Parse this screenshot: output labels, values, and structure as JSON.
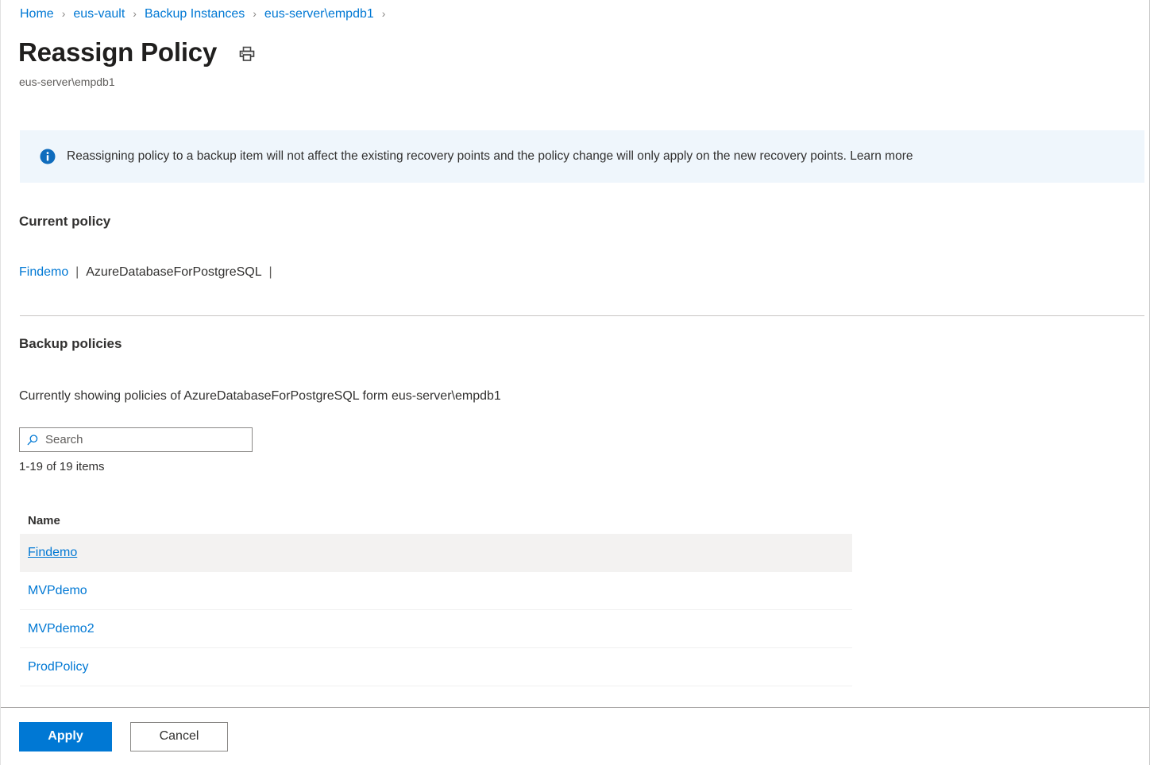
{
  "breadcrumb": {
    "items": [
      {
        "label": "Home"
      },
      {
        "label": "eus-vault"
      },
      {
        "label": "Backup Instances"
      },
      {
        "label": "eus-server\\empdb1"
      }
    ],
    "separator": "›"
  },
  "header": {
    "title": "Reassign Policy",
    "subtitle": "eus-server\\empdb1",
    "print_icon": "print-icon"
  },
  "info_banner": {
    "icon": "info-icon",
    "text": "Reassigning policy to a backup item will not affect the existing recovery points and the policy change will only apply on the new recovery points. Learn more",
    "background_color": "#eff6fc",
    "icon_color": "#0078d4"
  },
  "current_policy": {
    "heading": "Current policy",
    "policy_name": "Findemo",
    "pipe_1": "|",
    "datasource_type": "AzureDatabaseForPostgreSQL",
    "pipe_2": "|"
  },
  "backup_policies": {
    "heading": "Backup policies",
    "showing_text": "Currently showing policies of AzureDatabaseForPostgreSQL form eus-server\\empdb1",
    "search": {
      "placeholder": "Search",
      "value": "",
      "icon": "search-icon"
    },
    "items_count": "1-19 of 19 items",
    "columns": [
      "Name"
    ],
    "rows": [
      {
        "name": "Findemo",
        "selected": true
      },
      {
        "name": "MVPdemo",
        "selected": false
      },
      {
        "name": "MVPdemo2",
        "selected": false
      },
      {
        "name": "ProdPolicy",
        "selected": false
      }
    ]
  },
  "footer": {
    "apply_label": "Apply",
    "cancel_label": "Cancel",
    "accent_color": "#0078d4"
  }
}
